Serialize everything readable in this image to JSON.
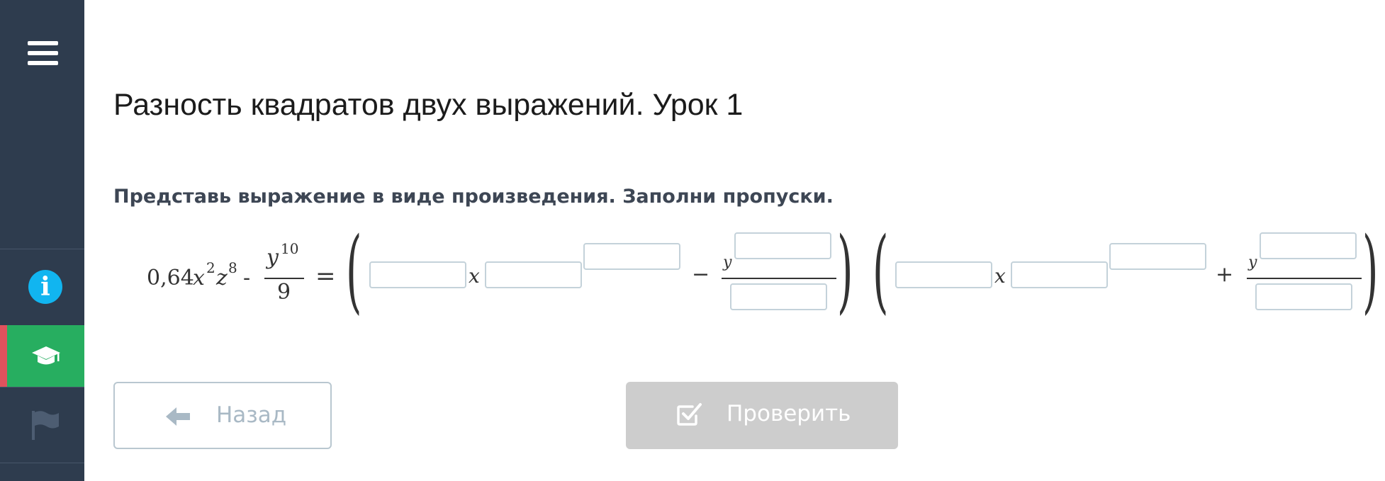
{
  "sidebar": {
    "info_glyph": "i",
    "items": [
      {
        "name": "menu",
        "icon": "hamburger-icon"
      },
      {
        "name": "info",
        "icon": "info-icon",
        "color": "#11b5f0"
      },
      {
        "name": "lesson",
        "icon": "graduation-cap-icon",
        "color": "#27ae60",
        "active": true
      },
      {
        "name": "flag",
        "icon": "flag-icon"
      }
    ]
  },
  "page": {
    "title": "Разность квадратов двух выражений. Урок 1",
    "task": "Представь выражение в виде произведения. Заполни пропуски."
  },
  "equation": {
    "coef": "0,64",
    "x": "x",
    "x_exp": "2",
    "z": "z",
    "z_exp": "8",
    "minus_sign": "-",
    "frac_num": "y",
    "frac_num_exp": "10",
    "frac_den": "9",
    "equals": "=",
    "open_paren": "(",
    "close_paren": ")",
    "factor1_sign": "−",
    "factor2_sign": "+",
    "inner_frac_num": "y",
    "blanks": [
      "",
      "",
      "",
      "",
      "",
      "",
      "",
      "",
      "",
      ""
    ]
  },
  "buttons": {
    "back": "Назад",
    "check": "Проверить"
  },
  "colors": {
    "sidebar": "#2e3c4e",
    "accent_green": "#27ae60",
    "accent_red": "#e0525d",
    "info_blue": "#11b5f0",
    "check_disabled": "#cdcdcd"
  }
}
